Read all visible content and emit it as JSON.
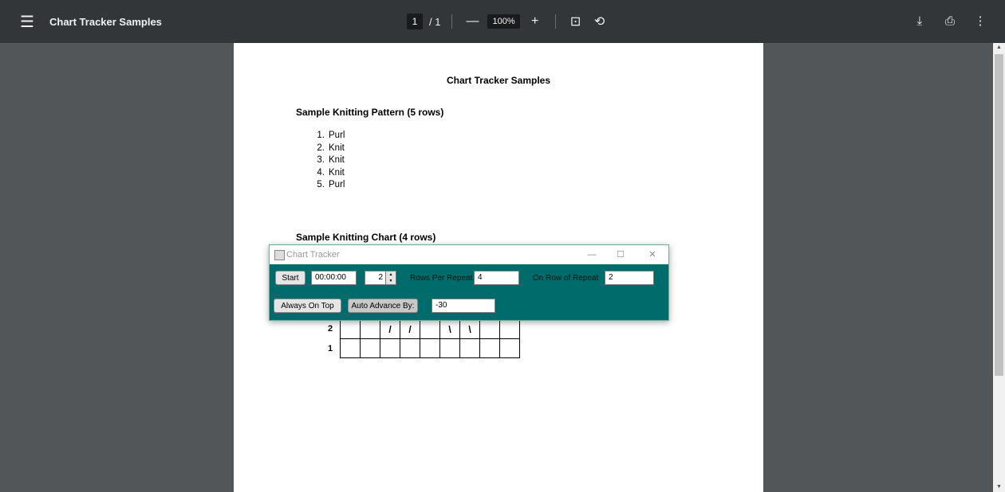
{
  "toolbar": {
    "title": "Chart Tracker Samples",
    "page_current": "1",
    "page_total": "/ 1",
    "zoom": "100%",
    "minus": "—",
    "plus": "+"
  },
  "document": {
    "heading": "Chart Tracker Samples",
    "pattern_heading": "Sample Knitting Pattern (5 rows)",
    "pattern_rows": [
      {
        "num": "1.",
        "stitch": "Purl"
      },
      {
        "num": "2.",
        "stitch": "Knit"
      },
      {
        "num": "3.",
        "stitch": "Knit"
      },
      {
        "num": "4.",
        "stitch": "Knit"
      },
      {
        "num": "5.",
        "stitch": "Purl"
      }
    ],
    "chart_heading": "Sample Knitting Chart (4 rows)",
    "chart_row_labels": [
      "2",
      "1"
    ],
    "chart_rows": [
      [
        "",
        "",
        "/",
        "/",
        "",
        "\\",
        "\\",
        "",
        ""
      ],
      [
        "",
        "",
        "",
        "",
        "",
        "",
        "",
        "",
        ""
      ]
    ]
  },
  "tracker": {
    "title": "Chart Tracker",
    "minimize": "—",
    "maximize": "☐",
    "close": "✕",
    "start_label": "Start",
    "timer": "00:00:00",
    "spinner_value": "2",
    "rows_per_repeat_label": "Rows Per Repeat",
    "rows_per_repeat_value": "4",
    "on_row_label": "On Row of Repeat",
    "on_row_value": "2",
    "always_on_top_label": "Always On Top",
    "auto_advance_label": "Auto Advance By:",
    "auto_advance_value": "-30"
  },
  "icons": {
    "menu": "☰",
    "fit": "⊡",
    "rotate": "⟲",
    "download": "⤓",
    "print": "⎙",
    "more": "⋮"
  }
}
